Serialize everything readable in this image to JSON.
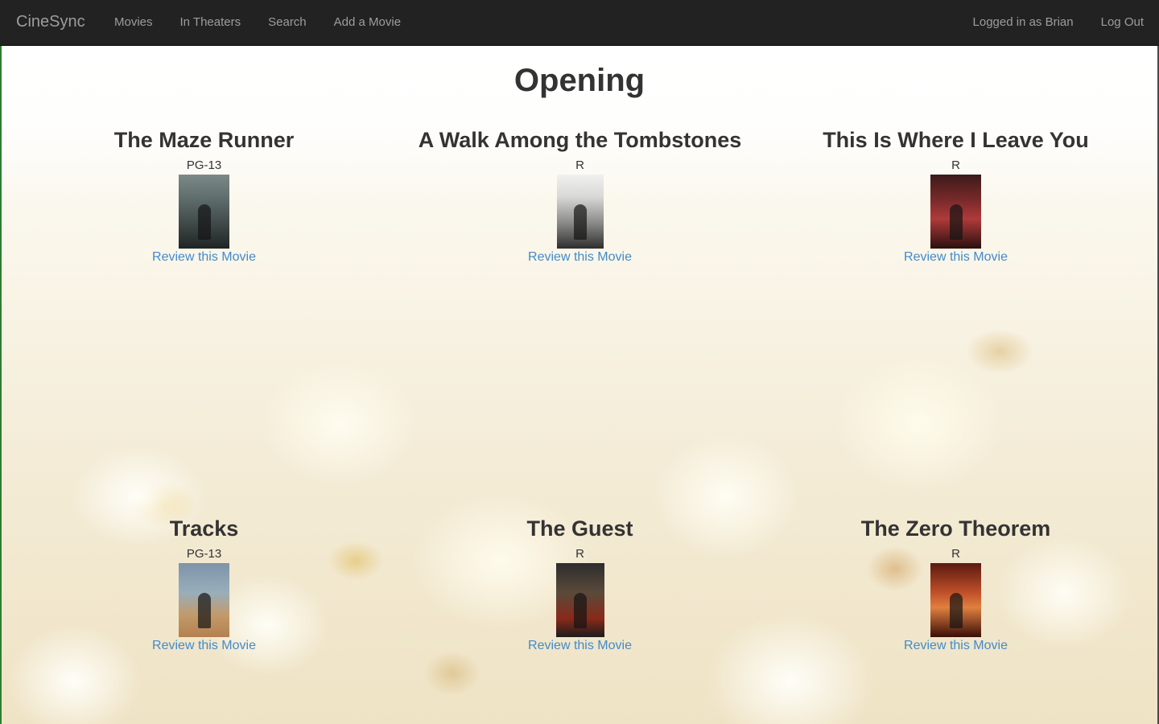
{
  "nav": {
    "brand": "CineSync",
    "links": [
      "Movies",
      "In Theaters",
      "Search",
      "Add a Movie"
    ],
    "user": "Logged in as Brian",
    "logout": "Log Out"
  },
  "page": {
    "title": "Opening"
  },
  "movies": [
    {
      "title": "The Maze Runner",
      "rating": "PG-13",
      "review": "Review this Movie",
      "poster": "maze-runner-poster"
    },
    {
      "title": "A Walk Among the Tombstones",
      "rating": "R",
      "review": "Review this Movie",
      "poster": "walk-among-tombstones-poster"
    },
    {
      "title": "This Is Where I Leave You",
      "rating": "R",
      "review": "Review this Movie",
      "poster": "this-is-where-i-leave-you-poster"
    },
    {
      "title": "Tracks",
      "rating": "PG-13",
      "review": "Review this Movie",
      "poster": "tracks-poster"
    },
    {
      "title": "The Guest",
      "rating": "R",
      "review": "Review this Movie",
      "poster": "the-guest-poster"
    },
    {
      "title": "The Zero Theorem",
      "rating": "R",
      "review": "Review this Movie",
      "poster": "zero-theorem-poster"
    }
  ],
  "colors": {
    "navbar": "#222222",
    "nav_text": "#9d9d9d",
    "link": "#428bca",
    "heading": "#333333"
  }
}
